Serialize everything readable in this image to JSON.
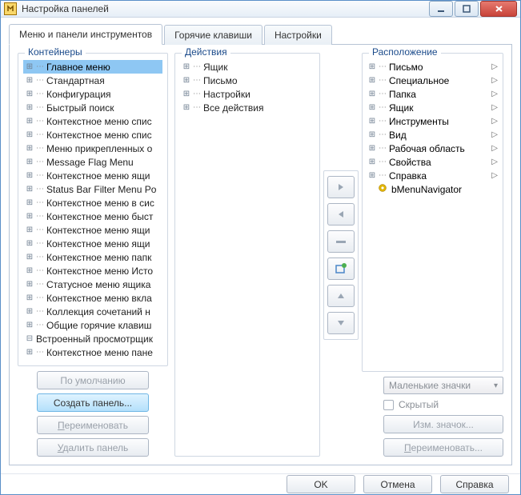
{
  "window": {
    "title": "Настройка панелей"
  },
  "tabs": [
    {
      "label": "Меню и панели инструментов",
      "active": true
    },
    {
      "label": "Горячие клавиши",
      "active": false
    },
    {
      "label": "Настройки",
      "active": false
    }
  ],
  "containers": {
    "label": "Контейнеры",
    "items": [
      {
        "label": "Главное меню",
        "expandable": true,
        "level": 1,
        "selected": true
      },
      {
        "label": "Стандартная",
        "expandable": true,
        "level": 1
      },
      {
        "label": "Конфигурация",
        "expandable": true,
        "level": 1
      },
      {
        "label": "Быстрый поиск",
        "expandable": true,
        "level": 1
      },
      {
        "label": "Контекстное меню спис",
        "expandable": true,
        "level": 1
      },
      {
        "label": "Контекстное меню спис",
        "expandable": true,
        "level": 1
      },
      {
        "label": "Меню прикрепленных о",
        "expandable": true,
        "level": 1
      },
      {
        "label": "Message Flag Menu",
        "expandable": true,
        "level": 1
      },
      {
        "label": "Контекстное меню ящи",
        "expandable": true,
        "level": 1
      },
      {
        "label": "Status Bar Filter Menu Po",
        "expandable": true,
        "level": 1
      },
      {
        "label": "Контекстное меню в сис",
        "expandable": true,
        "level": 1
      },
      {
        "label": "Контекстное меню быст",
        "expandable": true,
        "level": 1
      },
      {
        "label": "Контекстное меню ящи",
        "expandable": true,
        "level": 1
      },
      {
        "label": "Контекстное меню ящи",
        "expandable": true,
        "level": 1
      },
      {
        "label": "Контекстное меню папк",
        "expandable": true,
        "level": 1
      },
      {
        "label": "Контекстное меню Исто",
        "expandable": true,
        "level": 1
      },
      {
        "label": "Статусное меню ящика",
        "expandable": true,
        "level": 1
      },
      {
        "label": "Контекстное меню вкла",
        "expandable": true,
        "level": 1
      },
      {
        "label": "Коллекция сочетаний н",
        "expandable": true,
        "level": 1
      },
      {
        "label": "Общие горячие клавиш",
        "expandable": true,
        "level": 1
      },
      {
        "label": "Встроенный просмотрщик",
        "expandable": true,
        "level": 0,
        "expanded": true,
        "hasMinus": true
      },
      {
        "label": "Контекстное меню пане",
        "expandable": true,
        "level": 1
      }
    ],
    "buttons": {
      "default": "По умолчанию",
      "create": "Создать панель...",
      "rename": "Переименовать",
      "delete": "Удалить панель"
    }
  },
  "actions": {
    "label": "Действия",
    "items": [
      {
        "label": "Ящик"
      },
      {
        "label": "Письмо"
      },
      {
        "label": "Настройки"
      },
      {
        "label": "Все действия"
      }
    ]
  },
  "location": {
    "label": "Расположение",
    "items": [
      {
        "label": "Письмо",
        "submenu": true
      },
      {
        "label": "Специальное",
        "submenu": true
      },
      {
        "label": "Папка",
        "submenu": true
      },
      {
        "label": "Ящик",
        "submenu": true
      },
      {
        "label": "Инструменты",
        "submenu": true
      },
      {
        "label": "Вид",
        "submenu": true
      },
      {
        "label": "Рабочая область",
        "submenu": true
      },
      {
        "label": "Свойства",
        "submenu": true
      },
      {
        "label": "Справка",
        "submenu": true
      },
      {
        "label": "bMenuNavigator",
        "submenu": false,
        "gear": true
      }
    ],
    "icon_size": "Маленькие значки",
    "hidden_label": "Скрытый",
    "change_icon": "Изм. значок...",
    "rename": "Переименовать..."
  },
  "footer": {
    "ok": "OK",
    "cancel": "Отмена",
    "help": "Справка"
  },
  "underline_letters": {
    "rename_p": "П",
    "delete_u": "У",
    "loc_rename_p": "П"
  }
}
